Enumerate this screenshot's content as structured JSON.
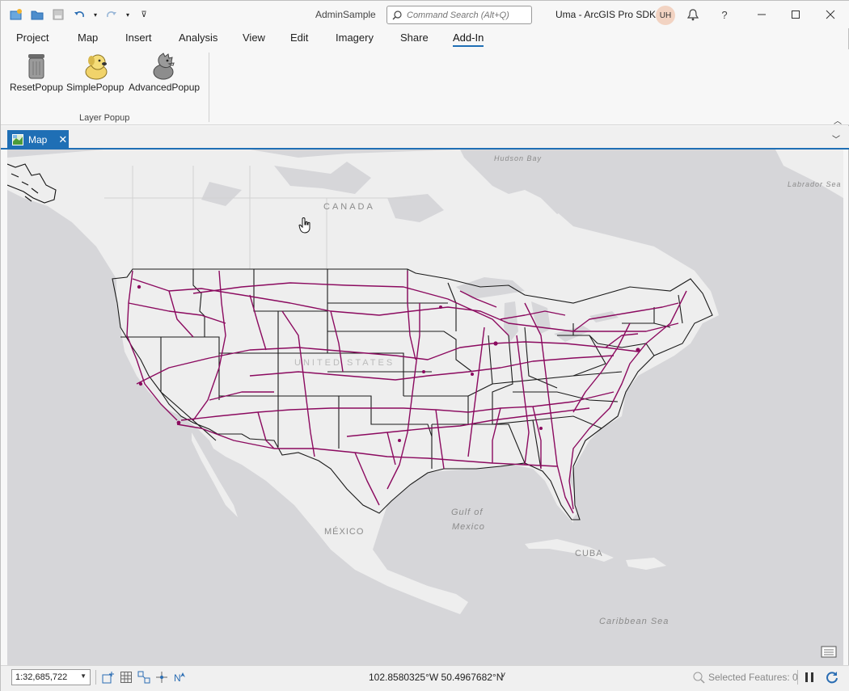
{
  "titlebar": {
    "doc_title": "AdminSample",
    "search_placeholder": "Command Search (Alt+Q)",
    "user_label": "Uma - ArcGIS Pro SDK",
    "avatar_initials": "UH",
    "notifications_icon": "bell-icon",
    "help_label": "?"
  },
  "tabs": [
    "Project",
    "Map",
    "Insert",
    "Analysis",
    "View",
    "Edit",
    "Imagery",
    "Share",
    "Add-In"
  ],
  "active_tab": "Add-In",
  "ribbon": {
    "buttons": [
      {
        "label": "ResetPopup",
        "icon": "trash-can-icon"
      },
      {
        "label": "SimplePopup",
        "icon": "dog-icon"
      },
      {
        "label": "AdvancedPopup",
        "icon": "dinosaur-icon"
      }
    ],
    "group_label": "Layer Popup"
  },
  "view_tab": {
    "label": "Map",
    "close": "✕"
  },
  "map_labels": {
    "canada": "CANADA",
    "usa": "UNITED STATES",
    "mexico": "MÉXICO",
    "gulf_line1": "Gulf of",
    "gulf_line2": "Mexico",
    "cuba": "CUBA",
    "caribbean": "Caribbean Sea",
    "hudson": "Hudson Bay",
    "labrador": "Labrador Sea"
  },
  "statusbar": {
    "scale": "1:32,685,722",
    "coordinates": "102.8580325°W 50.4967682°N",
    "selected_features": "Selected Features: 0"
  },
  "colors": {
    "accent": "#1f6fb5",
    "roads": "#8b0a5f",
    "land": "#eeeeee",
    "water": "#d6d6d9"
  }
}
